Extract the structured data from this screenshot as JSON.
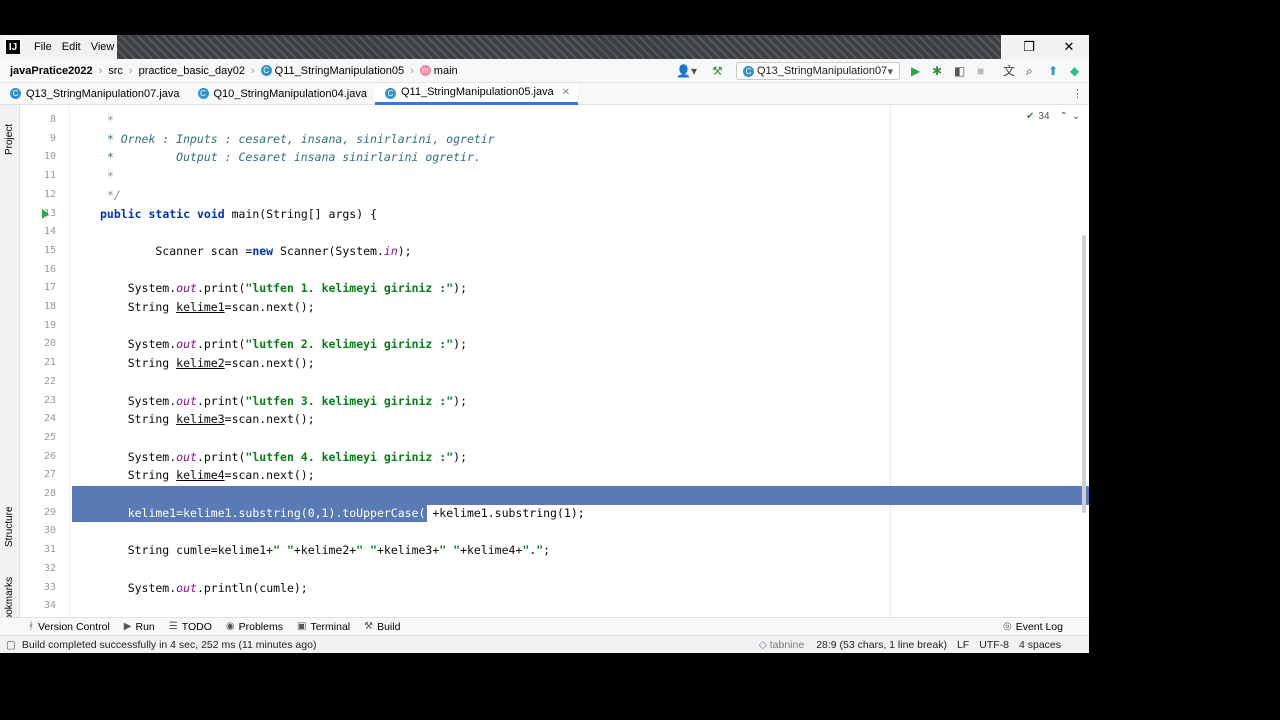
{
  "menu": {
    "items": [
      "File",
      "Edit",
      "View"
    ]
  },
  "app_logo_text": "IJ",
  "navbar": {
    "project": "javaPratice2022",
    "crumbs": [
      "src",
      "practice_basic_day02",
      "Q11_StringManipulation05",
      "main"
    ],
    "run_config": "Q13_StringManipulation07"
  },
  "tabs": [
    {
      "label": "Q13_StringManipulation07.java",
      "active": false
    },
    {
      "label": "Q10_StringManipulation04.java",
      "active": false
    },
    {
      "label": "Q11_StringManipulation05.java",
      "active": true
    }
  ],
  "left_strip": {
    "project": "Project",
    "structure": "Structure",
    "bookmarks": "Bookmarks"
  },
  "inspection_count": "34",
  "code_lines": [
    {
      "n": "8",
      "text": " *"
    },
    {
      "n": "9",
      "text": " * Ornek : Inputs : cesaret, insana, sinirlarini, ogretir"
    },
    {
      "n": "10",
      "text": " *         Output : Cesaret insana sinirlarini ogretir."
    },
    {
      "n": "11",
      "text": " *"
    },
    {
      "n": "12",
      "text": " */"
    },
    {
      "n": "13",
      "text": "public static void main(String[] args) {"
    },
    {
      "n": "14",
      "text": ""
    },
    {
      "n": "15",
      "text": "        Scanner scan =new Scanner(System.in);"
    },
    {
      "n": "16",
      "text": ""
    },
    {
      "n": "17",
      "text": "    System.out.print(\"lutfen 1. kelimeyi giriniz :\");"
    },
    {
      "n": "18",
      "text": "    String kelime1=scan.next();"
    },
    {
      "n": "19",
      "text": ""
    },
    {
      "n": "20",
      "text": "    System.out.print(\"lutfen 2. kelimeyi giriniz :\");"
    },
    {
      "n": "21",
      "text": "    String kelime2=scan.next();"
    },
    {
      "n": "22",
      "text": ""
    },
    {
      "n": "23",
      "text": "    System.out.print(\"lutfen 3. kelimeyi giriniz :\");"
    },
    {
      "n": "24",
      "text": "    String kelime3=scan.next();"
    },
    {
      "n": "25",
      "text": ""
    },
    {
      "n": "26",
      "text": "    System.out.print(\"lutfen 4. kelimeyi giriniz :\");"
    },
    {
      "n": "27",
      "text": "    String kelime4=scan.next();"
    },
    {
      "n": "28",
      "text": ""
    },
    {
      "n": "29",
      "text": "    kelime1=kelime1.substring(0,1).toUpperCase()+kelime1.substring(1);"
    },
    {
      "n": "30",
      "text": ""
    },
    {
      "n": "31",
      "text": "    String cumle=kelime1+\" \"+kelime2+\" \"+kelime3+\" \"+kelime4+\".\";"
    },
    {
      "n": "32",
      "text": ""
    },
    {
      "n": "33",
      "text": "    System.out.println(cumle);"
    },
    {
      "n": "34",
      "text": ""
    }
  ],
  "bottom_tools": [
    "Version Control",
    "Run",
    "TODO",
    "Problems",
    "Terminal",
    "Build"
  ],
  "event_log": "Event Log",
  "status": {
    "message": "Build completed successfully in 4 sec, 252 ms (11 minutes ago)",
    "plugin": "tabnine",
    "position": "28:9 (53 chars, 1 line break)",
    "line_sep": "LF",
    "encoding": "UTF-8",
    "indent": "4 spaces"
  },
  "taskbar": [
    "start",
    "search",
    "task-view",
    "edge",
    "file-explorer",
    "store",
    "acrobat",
    "photoshop",
    "sublime",
    "chrome",
    "intellij",
    "zoom",
    "slack",
    "whatsapp"
  ],
  "colors": {
    "selection": "#5a7ab5",
    "keyword": "#0033b3",
    "string": "#067d17",
    "accent": "#3574f0"
  }
}
